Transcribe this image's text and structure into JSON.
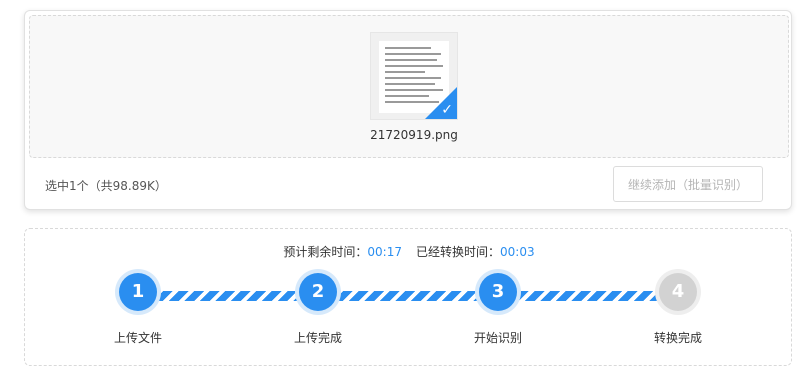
{
  "upload": {
    "file": {
      "name": "21720919.png",
      "selected": true
    },
    "selection_summary": "选中1个（共98.89K）",
    "batch_add_label": "继续添加（批量识别）"
  },
  "progress": {
    "remaining_label": "预计剩余时间：",
    "remaining_value": "00:17",
    "elapsed_label": "已经转换时间：",
    "elapsed_value": "00:03",
    "steps": [
      {
        "number": "1",
        "label": "上传文件",
        "state": "done"
      },
      {
        "number": "2",
        "label": "上传完成",
        "state": "done"
      },
      {
        "number": "3",
        "label": "开始识别",
        "state": "done"
      },
      {
        "number": "4",
        "label": "转换完成",
        "state": "todo"
      }
    ]
  },
  "colors": {
    "accent": "#2a8ef0",
    "inactive": "#d2d2d2"
  },
  "icons": {
    "selected_badge": "check-icon"
  }
}
